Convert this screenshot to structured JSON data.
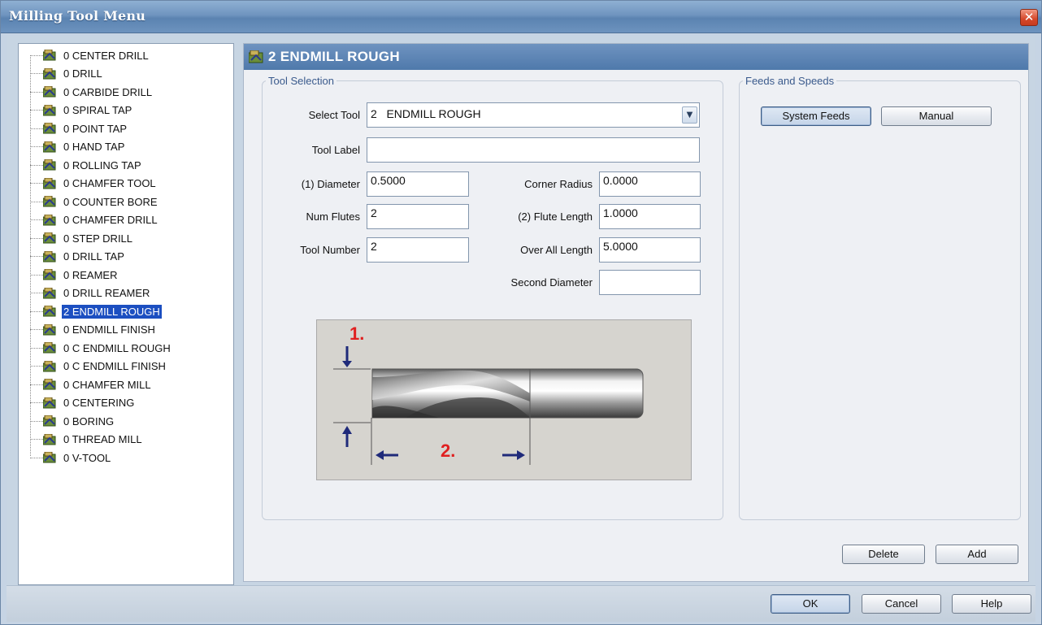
{
  "window": {
    "title": "Milling Tool Menu",
    "close_glyph": "✕"
  },
  "tree": {
    "items": [
      {
        "label": "0  CENTER DRILL",
        "icon": "tool-icon"
      },
      {
        "label": "0  DRILL",
        "icon": "tool-icon"
      },
      {
        "label": "0  CARBIDE DRILL",
        "icon": "tool-icon"
      },
      {
        "label": "0  SPIRAL TAP",
        "icon": "tool-icon"
      },
      {
        "label": "0  POINT TAP",
        "icon": "tool-icon"
      },
      {
        "label": "0  HAND TAP",
        "icon": "tool-icon"
      },
      {
        "label": "0  ROLLING TAP",
        "icon": "tool-icon"
      },
      {
        "label": "0  CHAMFER TOOL",
        "icon": "tool-icon"
      },
      {
        "label": "0  COUNTER BORE",
        "icon": "tool-icon"
      },
      {
        "label": "0  CHAMFER DRILL",
        "icon": "tool-icon"
      },
      {
        "label": "0  STEP DRILL",
        "icon": "tool-icon"
      },
      {
        "label": "0  DRILL TAP",
        "icon": "tool-icon"
      },
      {
        "label": "0  REAMER",
        "icon": "tool-icon"
      },
      {
        "label": "0  DRILL REAMER",
        "icon": "tool-icon"
      },
      {
        "label": "2  ENDMILL ROUGH",
        "icon": "tool-icon",
        "selected": true
      },
      {
        "label": "0  ENDMILL FINISH",
        "icon": "tool-icon"
      },
      {
        "label": "0  C ENDMILL ROUGH",
        "icon": "tool-icon"
      },
      {
        "label": "0  C ENDMILL FINISH",
        "icon": "tool-icon"
      },
      {
        "label": "0  CHAMFER MILL",
        "icon": "tool-icon"
      },
      {
        "label": "0  CENTERING",
        "icon": "tool-icon"
      },
      {
        "label": "0  BORING",
        "icon": "tool-icon"
      },
      {
        "label": "0  THREAD MILL",
        "icon": "tool-icon"
      },
      {
        "label": "0  V-TOOL",
        "icon": "tool-icon"
      }
    ]
  },
  "pane": {
    "header": "2  ENDMILL ROUGH",
    "tool_selection": {
      "legend": "Tool Selection",
      "select_tool_label": "Select Tool",
      "select_tool_value": "2   ENDMILL ROUGH",
      "tool_label_label": "Tool Label",
      "tool_label_value": "",
      "diameter_label": "(1) Diameter",
      "diameter_value": "0.5000",
      "num_flutes_label": "Num Flutes",
      "num_flutes_value": "2",
      "tool_number_label": "Tool Number",
      "tool_number_value": "2",
      "corner_radius_label": "Corner Radius",
      "corner_radius_value": "0.0000",
      "flute_length_label": "(2) Flute Length",
      "flute_length_value": "1.0000",
      "overall_length_label": "Over All Length",
      "overall_length_value": "5.0000",
      "second_diameter_label": "Second Diameter",
      "second_diameter_value": "",
      "diagram": {
        "marker_1": "1.",
        "marker_2": "2.",
        "marker_color": "#e02020",
        "arrow_color": "#1f2a7a"
      }
    },
    "feeds_and_speeds": {
      "legend": "Feeds and Speeds",
      "system_feeds_label": "System Feeds",
      "manual_label": "Manual"
    },
    "delete_label": "Delete",
    "add_label": "Add"
  },
  "footer": {
    "ok_label": "OK",
    "cancel_label": "Cancel",
    "help_label": "Help"
  }
}
